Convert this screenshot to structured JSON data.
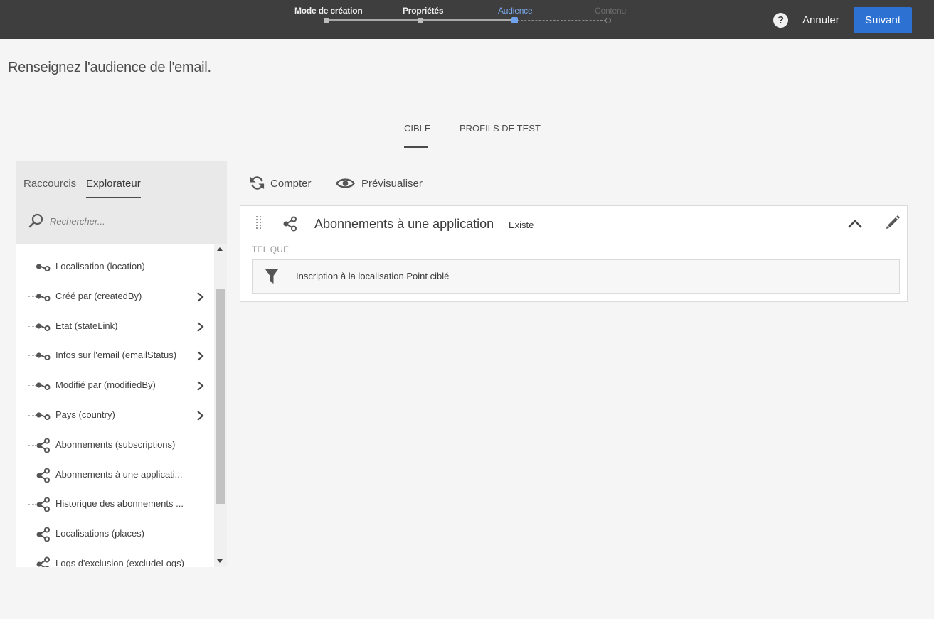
{
  "wizard": {
    "steps": [
      {
        "label": "Mode de création",
        "state": "done"
      },
      {
        "label": "Propriétés",
        "state": "done"
      },
      {
        "label": "Audience",
        "state": "active"
      },
      {
        "label": "Contenu",
        "state": "future"
      }
    ],
    "help_label": "?",
    "cancel_label": "Annuler",
    "next_label": "Suivant"
  },
  "page": {
    "title": "Renseignez l'audience de l'email."
  },
  "tabs": [
    {
      "label": "CIBLE",
      "active": true
    },
    {
      "label": "PROFILS DE TEST",
      "active": false
    }
  ],
  "left_panel": {
    "tabs": [
      {
        "label": "Raccourcis",
        "active": false
      },
      {
        "label": "Explorateur",
        "active": true
      }
    ],
    "search_placeholder": "Rechercher...",
    "items": [
      {
        "label": "Localisation (location)",
        "icon": "link-icon",
        "has_children": false
      },
      {
        "label": "Créé par (createdBy)",
        "icon": "link-icon",
        "has_children": true
      },
      {
        "label": "Etat (stateLink)",
        "icon": "link-icon",
        "has_children": true
      },
      {
        "label": "Infos sur l'email (emailStatus)",
        "icon": "link-icon",
        "has_children": true
      },
      {
        "label": "Modifié par (modifiedBy)",
        "icon": "link-icon",
        "has_children": true
      },
      {
        "label": "Pays (country)",
        "icon": "link-icon",
        "has_children": true
      },
      {
        "label": "Abonnements (subscriptions)",
        "icon": "collection-icon",
        "has_children": false
      },
      {
        "label": "Abonnements à une applicati...",
        "icon": "collection-icon",
        "has_children": false
      },
      {
        "label": "Historique des abonnements ...",
        "icon": "collection-icon",
        "has_children": false
      },
      {
        "label": "Localisations (places)",
        "icon": "collection-icon",
        "has_children": false
      },
      {
        "label": "Logs d'exclusion (excludeLogs)",
        "icon": "collection-icon",
        "has_children": false
      }
    ]
  },
  "toolbar": {
    "count_label": "Compter",
    "preview_label": "Prévisualiser"
  },
  "rule_card": {
    "title": "Abonnements à une application",
    "badge": "Existe",
    "subtitle": "TEL QUE",
    "filter_label": "Inscription à la localisation Point ciblé"
  },
  "colors": {
    "topbar": "#3e3e3e",
    "accent": "#2d72d2",
    "active_step": "#7aa8ea"
  }
}
